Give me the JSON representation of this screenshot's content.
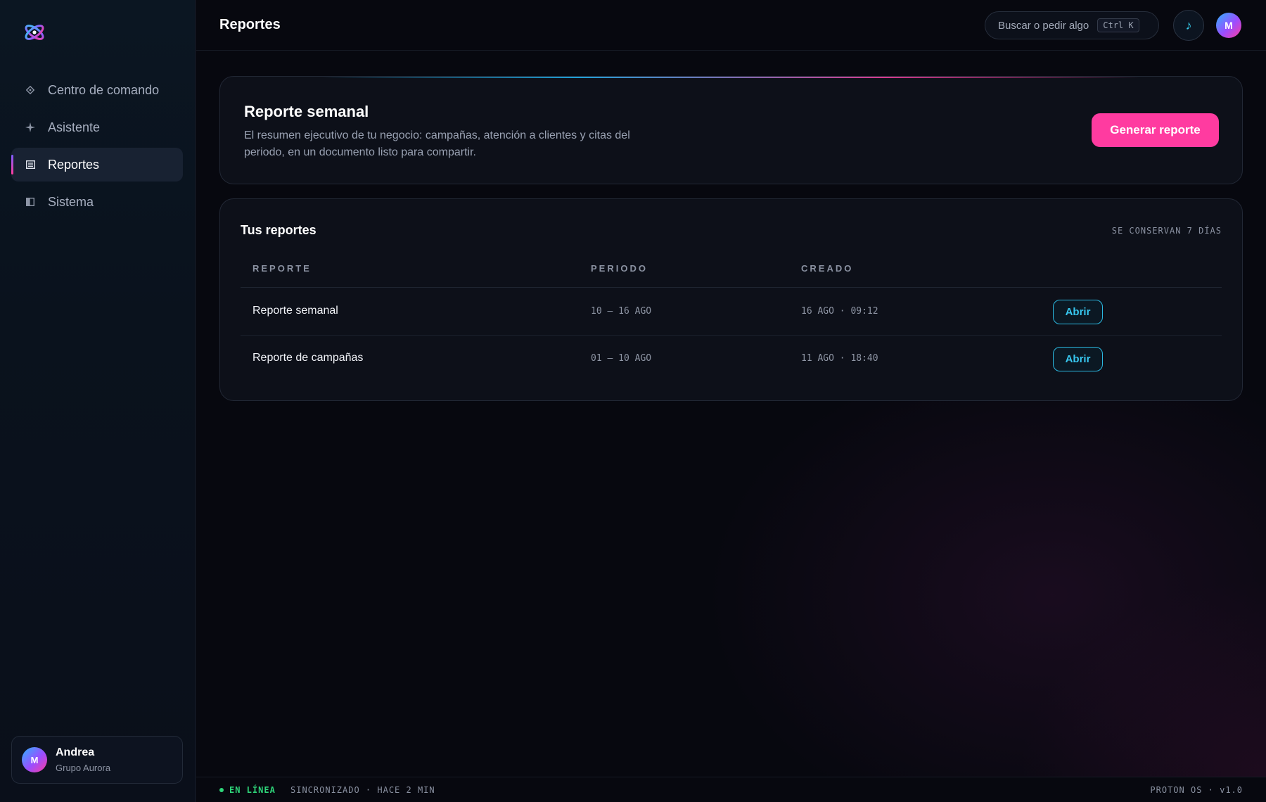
{
  "sidebar": {
    "items": [
      {
        "label": "Centro de comando",
        "icon": "diamond-icon"
      },
      {
        "label": "Asistente",
        "icon": "sparkle-icon"
      },
      {
        "label": "Reportes",
        "icon": "list-icon",
        "active": true
      },
      {
        "label": "Sistema",
        "icon": "panel-icon"
      }
    ],
    "user": {
      "initial": "M",
      "name": "Andrea",
      "org": "Grupo Aurora"
    }
  },
  "header": {
    "title": "Reportes",
    "search_placeholder": "Buscar o pedir algo",
    "shortcut": "Ctrl K",
    "music_glyph": "♪",
    "avatar_initial": "M"
  },
  "hero": {
    "title": "Reporte semanal",
    "description": "El resumen ejecutivo de tu negocio: campañas, atención a clientes y citas del periodo, en un documento listo para compartir.",
    "button": "Generar reporte"
  },
  "reports": {
    "title": "Tus reportes",
    "retention": "SE CONSERVAN 7 DÍAS",
    "columns": [
      "REPORTE",
      "PERIODO",
      "CREADO"
    ],
    "rows": [
      {
        "name": "Reporte semanal",
        "period": "10 — 16 AGO",
        "created": "16 AGO · 09:12",
        "action": "Abrir"
      },
      {
        "name": "Reporte de campañas",
        "period": "01 — 10 AGO",
        "created": "11 AGO · 18:40",
        "action": "Abrir"
      }
    ]
  },
  "footer": {
    "status": "EN LÍNEA",
    "sync": "SINCRONIZADO · HACE 2 MIN",
    "version": "PROTON OS · v1.0"
  },
  "colors": {
    "accent_pink": "#ff3ba0",
    "accent_cyan": "#37c6ee",
    "status_green": "#2fd67a",
    "background": "#07080f"
  }
}
